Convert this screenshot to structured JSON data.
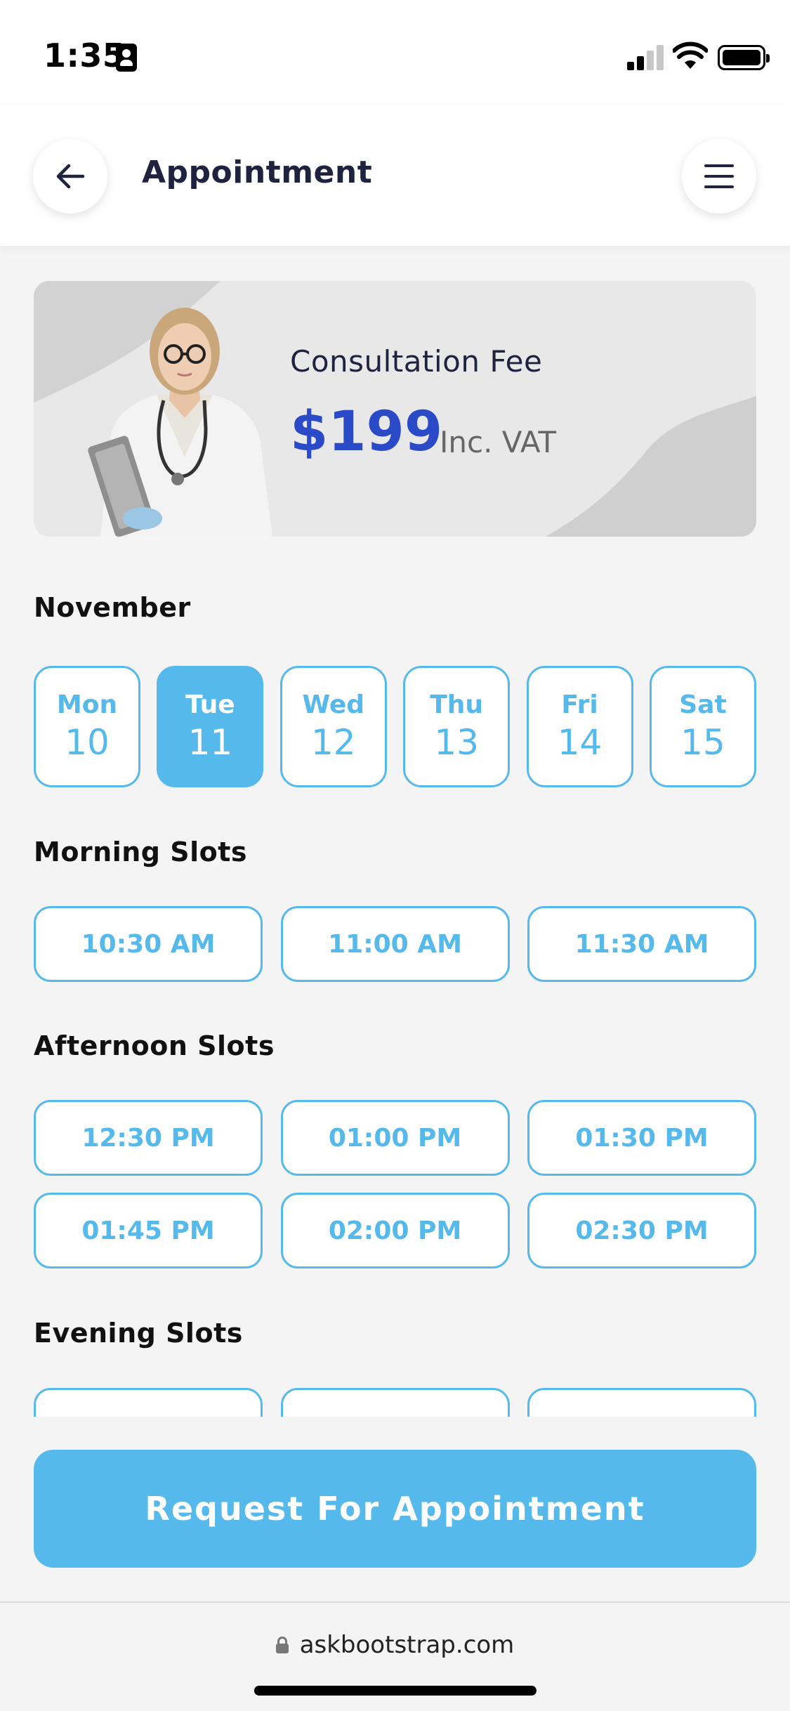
{
  "status_bar": {
    "time": "1:35"
  },
  "header": {
    "title": "Appointment"
  },
  "fee_card": {
    "label": "Consultation Fee",
    "amount": "$199",
    "vat": "Inc. VAT"
  },
  "month": "November",
  "days": [
    {
      "name": "Mon",
      "num": "10",
      "selected": false
    },
    {
      "name": "Tue",
      "num": "11",
      "selected": true
    },
    {
      "name": "Wed",
      "num": "12",
      "selected": false
    },
    {
      "name": "Thu",
      "num": "13",
      "selected": false
    },
    {
      "name": "Fri",
      "num": "14",
      "selected": false
    },
    {
      "name": "Sat",
      "num": "15",
      "selected": false
    }
  ],
  "morning": {
    "title": "Morning Slots",
    "slots": [
      "10:30 AM",
      "11:00 AM",
      "11:30 AM"
    ]
  },
  "afternoon": {
    "title": "Afternoon Slots",
    "slots": [
      "12:30 PM",
      "01:00 PM",
      "01:30 PM",
      "01:45 PM",
      "02:00 PM",
      "02:30 PM"
    ]
  },
  "evening": {
    "title": "Evening Slots"
  },
  "cta": {
    "label": "Request For Appointment"
  },
  "browser": {
    "url": "askbootstrap.com"
  },
  "colors": {
    "accent": "#56b9ec",
    "price": "#2b4ac8",
    "title": "#1f2340"
  }
}
